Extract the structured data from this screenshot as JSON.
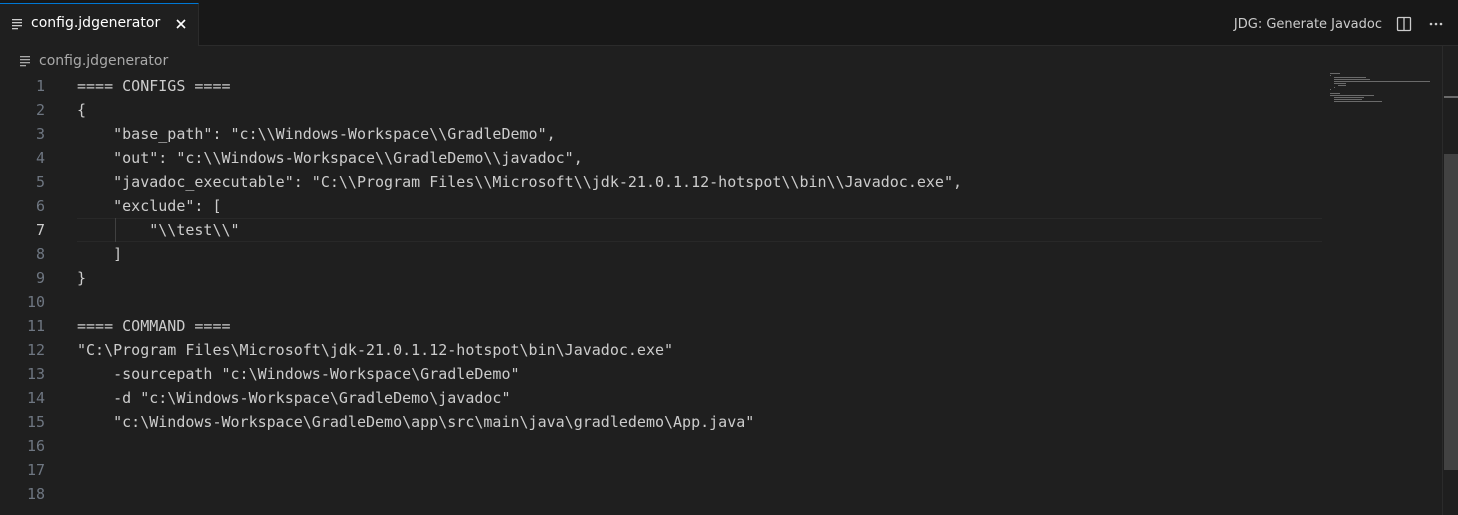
{
  "tab": {
    "label": "config.jdgenerator",
    "icon": "file-lines-icon"
  },
  "actions": {
    "command_label": "JDG: Generate Javadoc"
  },
  "breadcrumb": {
    "file": "config.jdgenerator"
  },
  "editor": {
    "active_line": 7,
    "line_numbers": [
      "1",
      "2",
      "3",
      "4",
      "5",
      "6",
      "7",
      "8",
      "9",
      "10",
      "11",
      "12",
      "13",
      "14",
      "15",
      "16",
      "17",
      "18"
    ],
    "lines": [
      "==== CONFIGS ====",
      "{",
      "    \"base_path\": \"c:\\\\Windows-Workspace\\\\GradleDemo\",",
      "    \"out\": \"c:\\\\Windows-Workspace\\\\GradleDemo\\\\javadoc\",",
      "    \"javadoc_executable\": \"C:\\\\Program Files\\\\Microsoft\\\\jdk-21.0.1.12-hotspot\\\\bin\\\\Javadoc.exe\",",
      "    \"exclude\": [",
      "        \"\\\\test\\\\\"",
      "    ]",
      "}",
      "",
      "==== COMMAND ====",
      "\"C:\\Program Files\\Microsoft\\jdk-21.0.1.12-hotspot\\bin\\Javadoc.exe\"",
      "    -sourcepath \"c:\\Windows-Workspace\\GradleDemo\"",
      "    -d \"c:\\Windows-Workspace\\GradleDemo\\javadoc\"",
      "    \"c:\\Windows-Workspace\\GradleDemo\\app\\src\\main\\java\\gradledemo\\App.java\"",
      "",
      "",
      ""
    ]
  },
  "colors": {
    "editor_bg": "#1f1f1f",
    "tabbar_bg": "#181818",
    "text": "#cccccc",
    "line_number": "#6e7681",
    "active_tab_border": "#0078d4"
  }
}
